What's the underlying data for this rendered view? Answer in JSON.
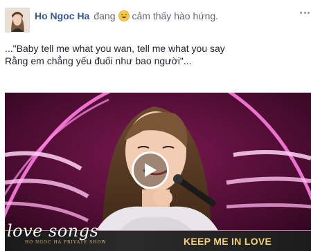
{
  "post": {
    "author": "Ho Ngoc Ha",
    "verb": "đang",
    "feeling_icon": "smiling-emoji-icon",
    "feeling_text": "cảm thấy hào hứng.",
    "more_icon": "more-options-icon"
  },
  "text": {
    "line1": "...\"Baby tell me what you wan, tell me what you say",
    "line2": "Rằng em chẳng yếu đuối như bao người\"..."
  },
  "video": {
    "brand_text": "love songs",
    "brand_subtext": "HO NGOC HA PRIVATE SHOW",
    "title": "KEEP ME IN LOVE",
    "play_icon": "play-icon"
  },
  "colors": {
    "author": "#365899",
    "meta": "#616770",
    "text": "#1d2129",
    "banner_title": "#f3d27a"
  }
}
